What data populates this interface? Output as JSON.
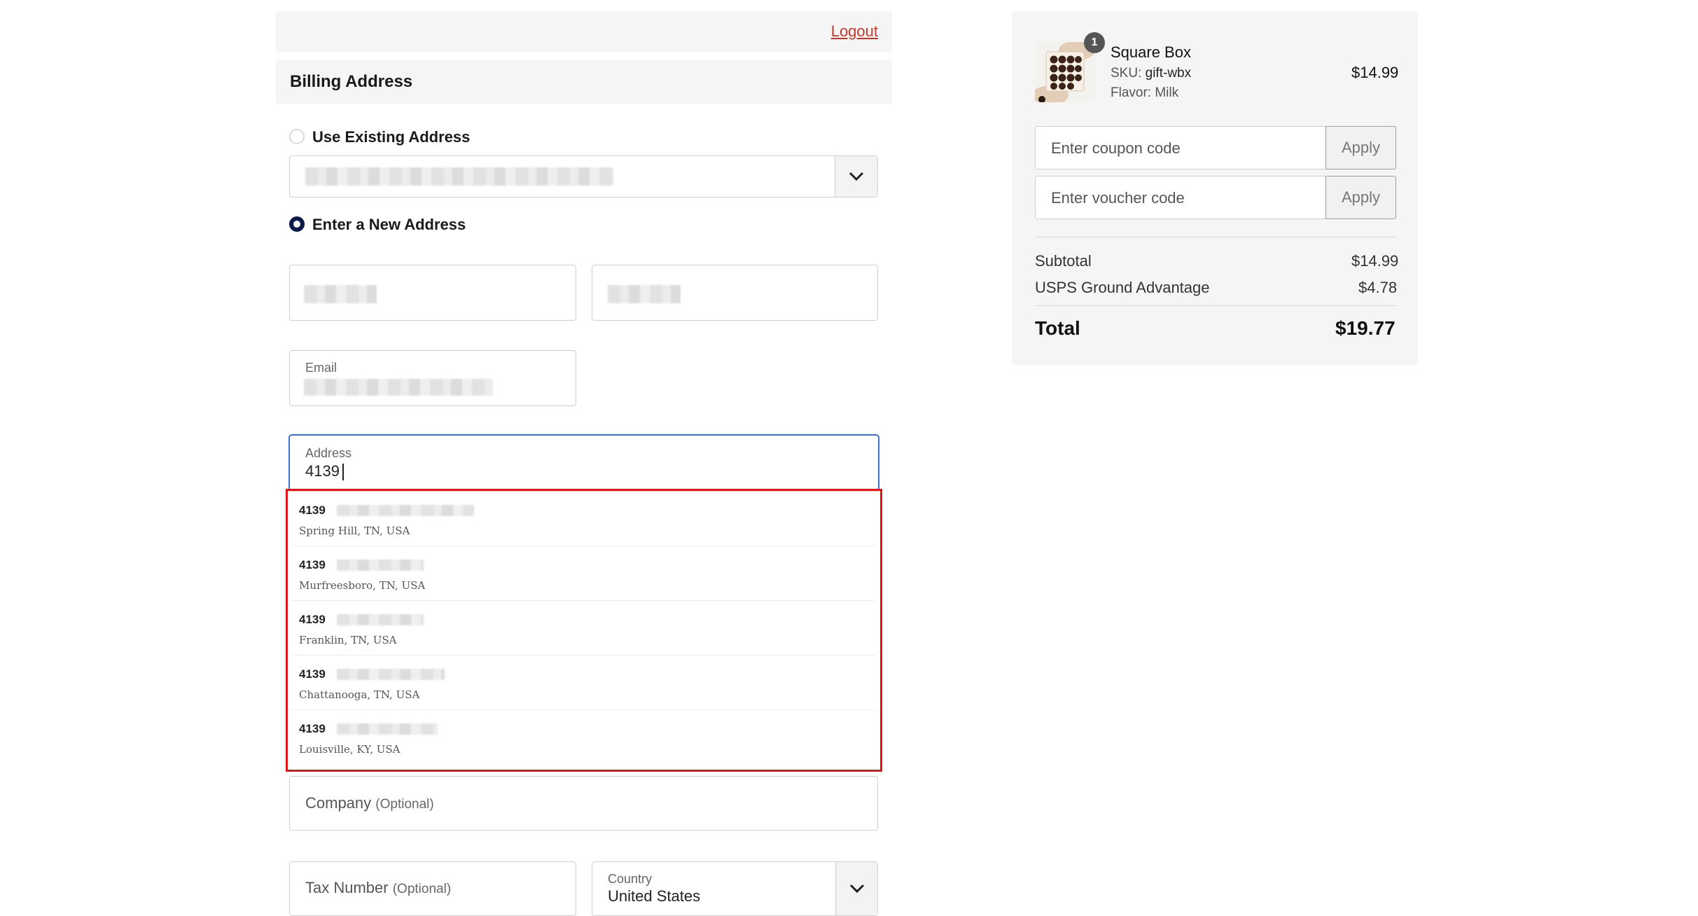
{
  "header": {
    "logout_label": "Logout"
  },
  "billing": {
    "title": "Billing Address",
    "use_existing_label": "Use Existing Address",
    "enter_new_label": "Enter a New Address"
  },
  "form": {
    "email_label": "Email",
    "address_label": "Address",
    "address_value": "4139",
    "company_placeholder": "Company",
    "optional_suffix": "(Optional)",
    "tax_placeholder": "Tax Number",
    "country_label": "Country",
    "country_value": "United States"
  },
  "suggestions": [
    {
      "number": "4139",
      "city": "Spring Hill, TN, USA"
    },
    {
      "number": "4139",
      "city": "Murfreesboro, TN, USA"
    },
    {
      "number": "4139",
      "city": "Franklin, TN, USA"
    },
    {
      "number": "4139",
      "city": "Chattanooga, TN, USA"
    },
    {
      "number": "4139",
      "city": "Louisville, KY, USA"
    }
  ],
  "cart": {
    "badge_count": "1",
    "product_name": "Square Box",
    "sku_label": "SKU:",
    "sku_value": "gift-wbx",
    "flavor_label": "Flavor:",
    "flavor_value": "Milk",
    "price": "$14.99",
    "coupon_placeholder": "Enter coupon code",
    "voucher_placeholder": "Enter voucher code",
    "apply_label": "Apply",
    "subtotal_label": "Subtotal",
    "subtotal_value": "$14.99",
    "shipping_label": "USPS Ground Advantage",
    "shipping_value": "$4.78",
    "total_label": "Total",
    "total_value": "$19.77"
  },
  "colors": {
    "accent_focus": "#3b6fd8",
    "highlight_box": "#e01515",
    "radio_checked": "#0b1a4a",
    "logout_link": "#c0392b"
  }
}
